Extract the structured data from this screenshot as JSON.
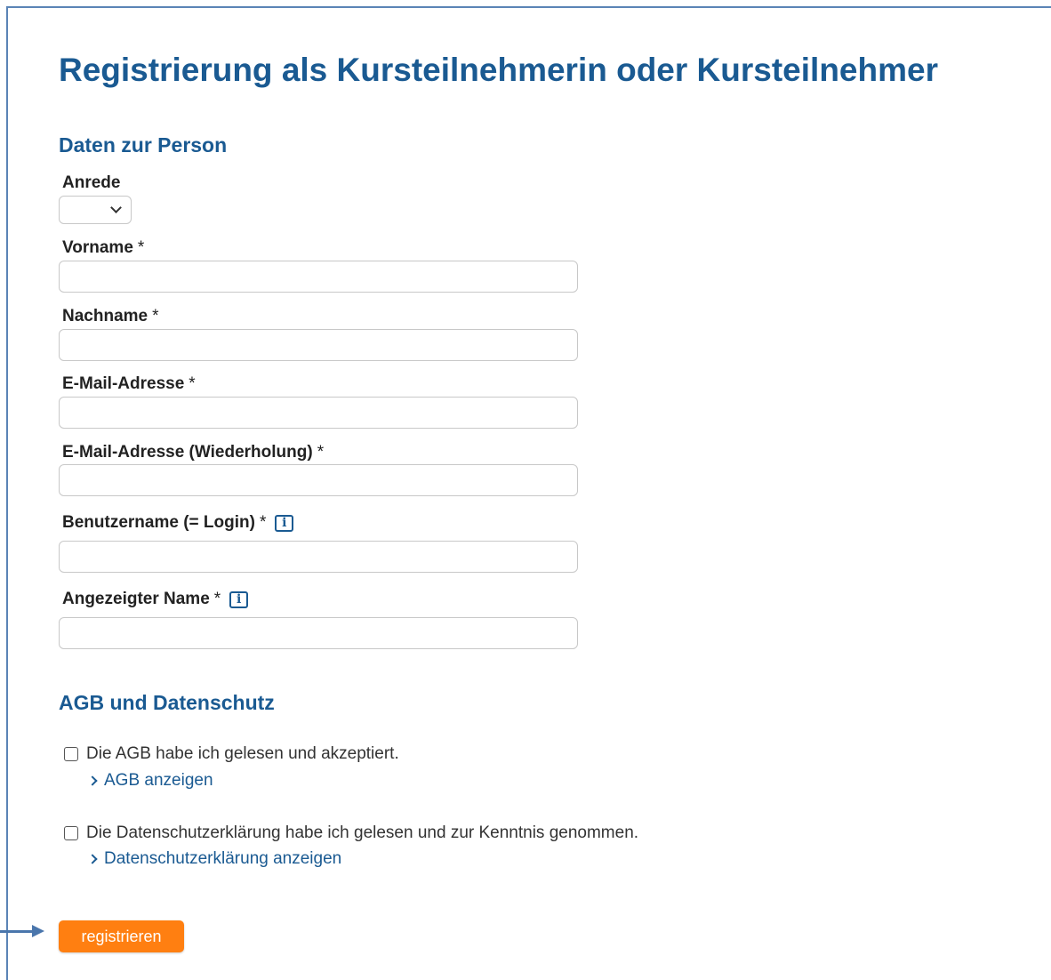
{
  "page": {
    "title": "Registrierung als Kursteilnehmerin oder Kursteilnehmer"
  },
  "person_section": {
    "title": "Daten zur Person",
    "salutation": {
      "label": "Anrede",
      "value": ""
    },
    "required_mark": "*",
    "info_glyph": "i",
    "fields": {
      "first_name": {
        "label": "Vorname",
        "value": ""
      },
      "last_name": {
        "label": "Nachname",
        "value": ""
      },
      "email": {
        "label": "E-Mail-Adresse",
        "value": ""
      },
      "email_repeat": {
        "label": "E-Mail-Adresse (Wiederholung)",
        "value": ""
      },
      "username": {
        "label": "Benutzername (= Login)",
        "value": ""
      },
      "display_name": {
        "label": "Angezeigter Name",
        "value": ""
      }
    }
  },
  "terms_section": {
    "title": "AGB und Datenschutz",
    "agb": {
      "checkbox_label": "Die AGB habe ich gelesen und akzeptiert.",
      "link": "AGB anzeigen",
      "checked": false
    },
    "privacy": {
      "checkbox_label": "Die Datenschutzerklärung habe ich gelesen und zur Kenntnis genommen.",
      "link": "Datenschutzerklärung anzeigen",
      "checked": false
    }
  },
  "submit": {
    "label": "registrieren"
  },
  "colors": {
    "heading": "#1a5a92",
    "button": "#ff7f11",
    "frame": "#5b84b6",
    "annotation_arrow": "#4a76ac"
  },
  "icons": {
    "info": "info-icon",
    "select_chevron": "chevron-down-icon",
    "link_chevron": "chevron-right-icon",
    "annotation": "arrow-right-icon"
  }
}
